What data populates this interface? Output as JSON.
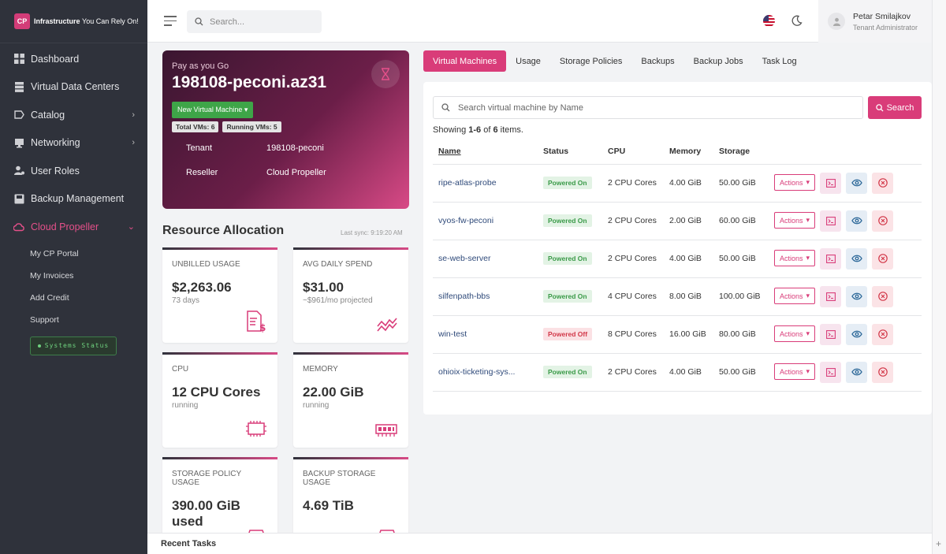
{
  "brand": {
    "logo": "CP",
    "name": "Infrastructure",
    "tagline": "You Can Rely On!"
  },
  "sidebar": {
    "items": [
      {
        "label": "Dashboard",
        "icon": "dashboard-icon"
      },
      {
        "label": "Virtual Data Centers",
        "icon": "datacenter-icon"
      },
      {
        "label": "Catalog",
        "icon": "tag-icon",
        "chevron": "›"
      },
      {
        "label": "Networking",
        "icon": "monitor-icon",
        "chevron": "›"
      },
      {
        "label": "User Roles",
        "icon": "user-roles-icon"
      },
      {
        "label": "Backup Management",
        "icon": "backup-icon"
      },
      {
        "label": "Cloud Propeller",
        "icon": "cloud-icon",
        "chevron": "⌄"
      }
    ],
    "subitems": [
      "My CP Portal",
      "My Invoices",
      "Add Credit",
      "Support"
    ],
    "status_button": "Systems Status"
  },
  "header": {
    "search_placeholder": "Search...",
    "user_name": "Petar Smilajkov",
    "user_role": "Tenant Administrator"
  },
  "account": {
    "plan": "Pay as you Go",
    "title": "198108-peconi.az31",
    "new_vm_label": "New Virtual Machine",
    "total_vms": "Total VMs: 6",
    "running_vms": "Running VMs: 5",
    "tenant_label": "Tenant",
    "tenant_value": "198108-peconi",
    "reseller_label": "Reseller",
    "reseller_value": "Cloud Propeller"
  },
  "resources": {
    "title": "Resource Allocation",
    "last_sync": "Last sync: 9:19:20 AM",
    "cards": [
      {
        "label": "UNBILLED USAGE",
        "value": "$2,263.06",
        "sub": "73 days"
      },
      {
        "label": "AVG DAILY SPEND",
        "value": "$31.00",
        "sub": "~$961/mo projected"
      },
      {
        "label": "CPU",
        "value": "12 CPU Cores",
        "sub": "running"
      },
      {
        "label": "MEMORY",
        "value": "22.00 GiB",
        "sub": "running"
      },
      {
        "label": "STORAGE POLICY USAGE",
        "value": "390.00 GiB used",
        "sub": ""
      },
      {
        "label": "BACKUP STORAGE USAGE",
        "value": "4.69 TiB",
        "sub": ""
      }
    ]
  },
  "tabs": [
    "Virtual Machines",
    "Usage",
    "Storage Policies",
    "Backups",
    "Backup Jobs",
    "Task Log"
  ],
  "vm_panel": {
    "search_placeholder": "Search virtual machine by Name",
    "search_button": "Search",
    "showing_prefix": "Showing ",
    "showing_range": "1-6",
    "showing_mid": " of ",
    "showing_total": "6",
    "showing_suffix": " items.",
    "columns": [
      "Name",
      "Status",
      "CPU",
      "Memory",
      "Storage"
    ],
    "actions_label": "Actions",
    "rows": [
      {
        "name": "ripe-atlas-probe",
        "status": "Powered On",
        "cpu": "2 CPU Cores",
        "memory": "4.00 GiB",
        "storage": "50.00 GiB"
      },
      {
        "name": "vyos-fw-peconi",
        "status": "Powered On",
        "cpu": "2 CPU Cores",
        "memory": "2.00 GiB",
        "storage": "60.00 GiB"
      },
      {
        "name": "se-web-server",
        "status": "Powered On",
        "cpu": "2 CPU Cores",
        "memory": "4.00 GiB",
        "storage": "50.00 GiB"
      },
      {
        "name": "silfenpath-bbs",
        "status": "Powered On",
        "cpu": "4 CPU Cores",
        "memory": "8.00 GiB",
        "storage": "100.00 GiB"
      },
      {
        "name": "win-test",
        "status": "Powered Off",
        "cpu": "8 CPU Cores",
        "memory": "16.00 GiB",
        "storage": "80.00 GiB"
      },
      {
        "name": "ohioix-ticketing-sys...",
        "status": "Powered On",
        "cpu": "2 CPU Cores",
        "memory": "4.00 GiB",
        "storage": "50.00 GiB"
      }
    ]
  },
  "footer": {
    "recent_tasks": "Recent Tasks",
    "expand": "+"
  },
  "colors": {
    "accent": "#d93c79",
    "sidebar": "#2f323b",
    "success": "#3ea548",
    "danger": "#d23748"
  }
}
